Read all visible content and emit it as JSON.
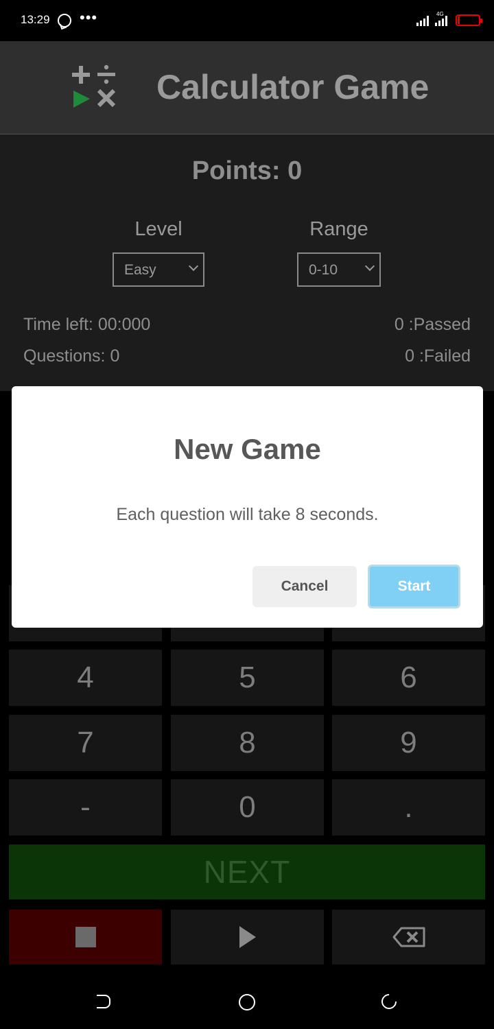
{
  "status_bar": {
    "time": "13:29",
    "more": "•••",
    "network_type": "4G",
    "icons": [
      "whatsapp-icon",
      "more-icon",
      "signal-icon",
      "signal-4g-icon",
      "battery-low-icon"
    ]
  },
  "header": {
    "title": "Calculator Game",
    "logo": "math-operators-logo"
  },
  "scoreboard": {
    "points": "Points: 0",
    "level_label": "Level",
    "level_value": "Easy",
    "range_label": "Range",
    "range_value": "0-10",
    "time_left": "Time left: 00:000",
    "questions": "Questions: 0",
    "passed": "0 :Passed",
    "failed": "0 :Failed"
  },
  "keypad": {
    "keys": [
      "4",
      "5",
      "6",
      "7",
      "8",
      "9",
      "-",
      "0",
      "."
    ],
    "next_label": "NEXT",
    "controls": [
      "stop-icon",
      "play-icon",
      "backspace-icon"
    ]
  },
  "dialog": {
    "title": "New Game",
    "message": "Each question will take 8 seconds.",
    "cancel_label": "Cancel",
    "start_label": "Start"
  },
  "colors": {
    "header_bg": "#2f2f2f",
    "panel_bg": "#1c1c1c",
    "key_bg": "#161616",
    "next_bg": "#0c3507",
    "stop_bg": "#3d0000",
    "start_button": "#80d0f6",
    "logo_green": "#1e8a3c",
    "battery_red": "#e00000"
  }
}
